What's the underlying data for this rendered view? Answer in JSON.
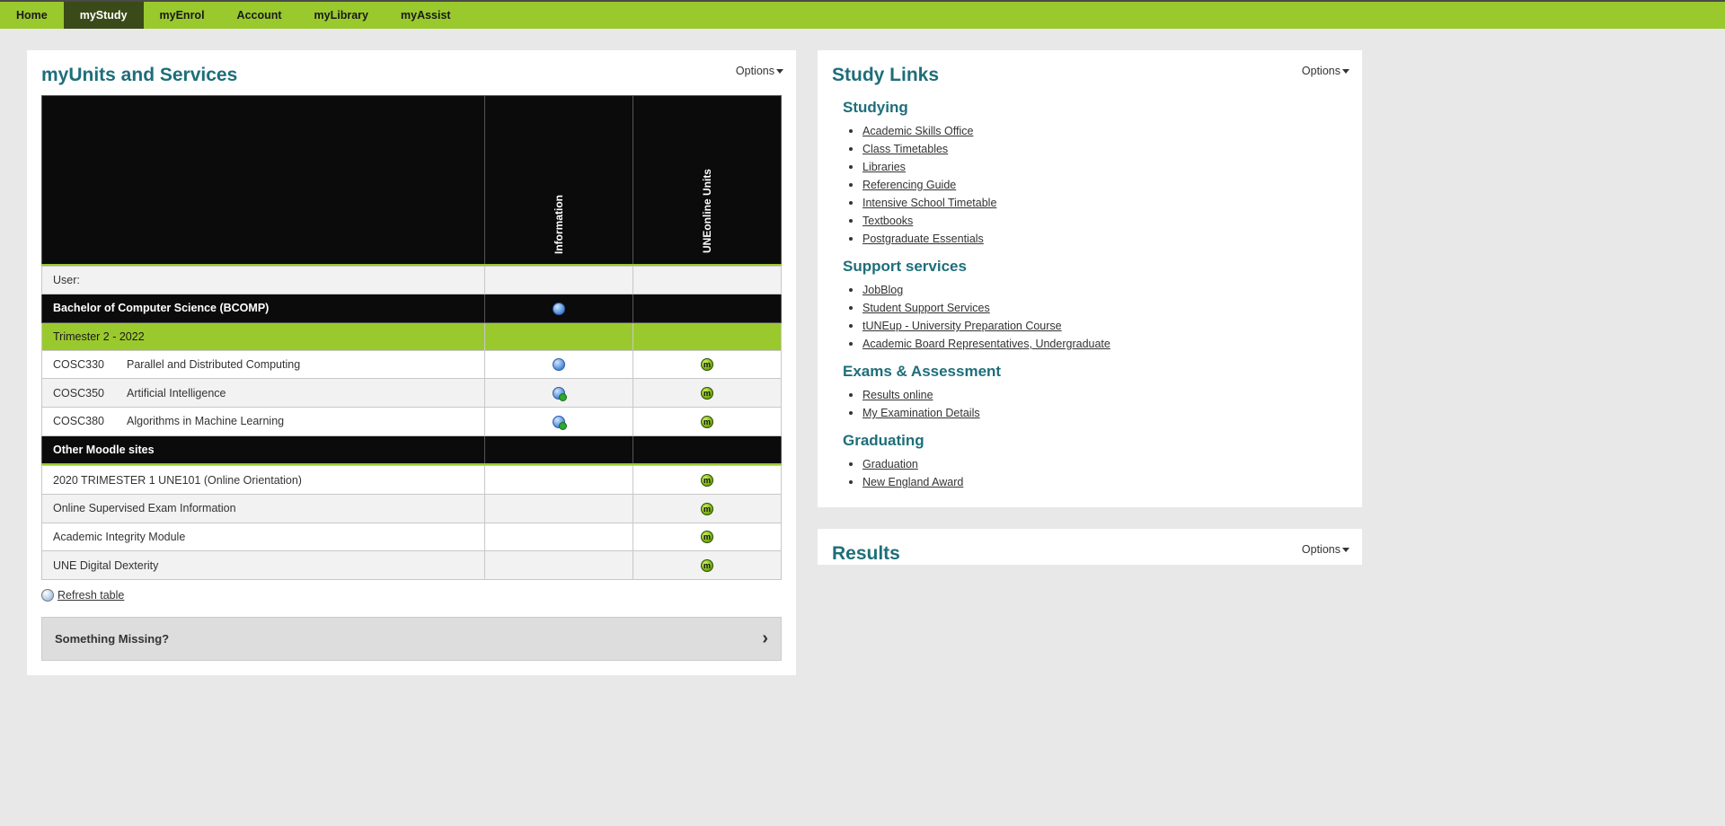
{
  "nav": {
    "items": [
      "Home",
      "myStudy",
      "myEnrol",
      "Account",
      "myLibrary",
      "myAssist"
    ],
    "active_index": 1
  },
  "units_panel": {
    "title": "myUnits and Services",
    "options_label": "Options",
    "headers": {
      "c0": "",
      "c1": "Information",
      "c2": "UNEonline Units"
    },
    "user_row_label": "User:",
    "program_row": "Bachelor of Computer Science (BCOMP)",
    "term_row": "Trimester 2 - 2022",
    "units": [
      {
        "code": "COSC330",
        "name": "Parallel and Distributed Computing",
        "info_check": false
      },
      {
        "code": "COSC350",
        "name": "Artificial Intelligence",
        "info_check": true
      },
      {
        "code": "COSC380",
        "name": "Algorithms in Machine Learning",
        "info_check": true
      }
    ],
    "other_header": "Other Moodle sites",
    "other_sites": [
      "2020 TRIMESTER 1 UNE101 (Online Orientation)",
      "Online Supervised Exam Information",
      "Academic Integrity Module",
      "UNE Digital Dexterity"
    ],
    "refresh_label": "Refresh table",
    "missing_label": "Something Missing?"
  },
  "study_links": {
    "title": "Study Links",
    "options_label": "Options",
    "sections": [
      {
        "heading": "Studying",
        "links": [
          "Academic Skills Office",
          "Class Timetables",
          "Libraries",
          "Referencing Guide",
          "Intensive School Timetable",
          "Textbooks",
          "Postgraduate Essentials"
        ]
      },
      {
        "heading": "Support services",
        "links": [
          "JobBlog",
          "Student Support Services",
          "tUNEup - University Preparation Course",
          "Academic Board Representatives, Undergraduate"
        ]
      },
      {
        "heading": "Exams & Assessment",
        "links": [
          "Results online",
          "My Examination Details"
        ]
      },
      {
        "heading": "Graduating",
        "links": [
          "Graduation",
          "New England Award"
        ]
      }
    ]
  },
  "results_panel": {
    "title": "Results",
    "options_label": "Options"
  }
}
